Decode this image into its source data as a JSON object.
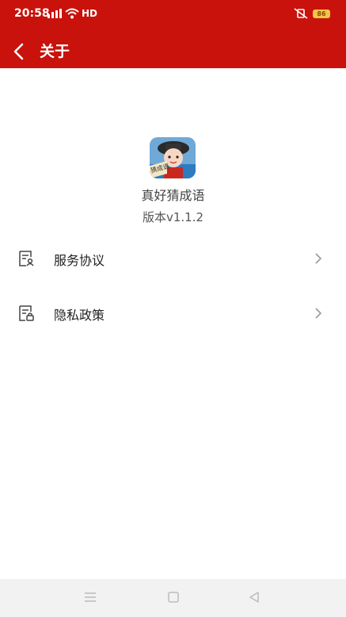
{
  "status_bar": {
    "time": "20:58",
    "network": "HD",
    "battery": "86"
  },
  "header": {
    "title": "关于",
    "background": "#c8120b"
  },
  "app": {
    "name": "真好猜成语",
    "version": "版本v1.1.2",
    "logo_text": "猜成语"
  },
  "menu": {
    "items": [
      {
        "label": "服务协议",
        "icon": "document-user-icon"
      },
      {
        "label": "隐私政策",
        "icon": "document-lock-icon"
      }
    ]
  },
  "nav_bar": {
    "buttons": [
      "menu-icon",
      "home-icon",
      "back-triangle-icon"
    ]
  }
}
